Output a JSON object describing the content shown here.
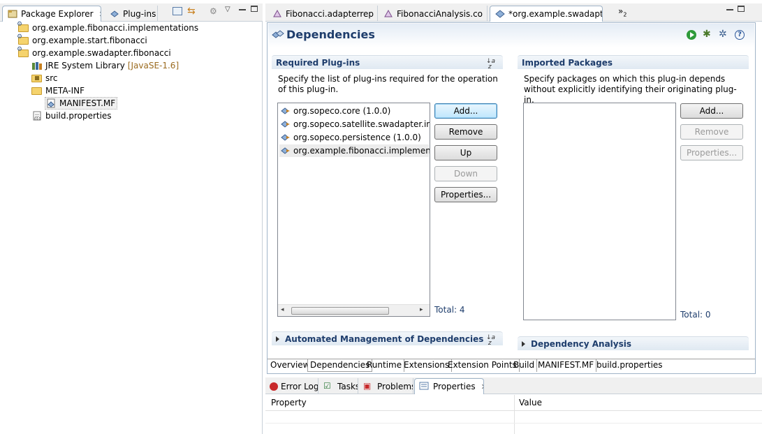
{
  "left_view": {
    "tabs": [
      {
        "label": "Package Explorer",
        "active": true
      },
      {
        "label": "Plug-ins",
        "active": false
      }
    ],
    "tree": [
      {
        "label": "org.example.fibonacci.implementations",
        "icon": "plugin-project-icon",
        "indent": 0
      },
      {
        "label": "org.example.start.fibonacci",
        "icon": "plugin-project-icon",
        "indent": 0
      },
      {
        "label": "org.example.swadapter.fibonacci",
        "icon": "plugin-project-icon",
        "indent": 0
      },
      {
        "label": "JRE System Library",
        "suffix": "[JavaSE-1.6]",
        "icon": "library-icon",
        "indent": 1
      },
      {
        "label": "src",
        "icon": "source-folder-icon",
        "indent": 1
      },
      {
        "label": "META-INF",
        "icon": "folder-icon",
        "indent": 1
      },
      {
        "label": "MANIFEST.MF",
        "icon": "manifest-file-icon",
        "indent": 2
      },
      {
        "label": "build.properties",
        "icon": "properties-file-icon",
        "indent": 1
      }
    ]
  },
  "editor": {
    "tabs": [
      {
        "label": "Fibonacci.adapterrep",
        "active": false
      },
      {
        "label": "FibonacciAnalysis.co",
        "active": false
      },
      {
        "label": "*org.example.swadapt",
        "active": true
      }
    ],
    "overflow_count": "2",
    "title": "Dependencies",
    "required": {
      "heading": "Required Plug-ins",
      "description": "Specify the list of plug-ins required for the operation of this plug-in.",
      "items": [
        "org.sopeco.core (1.0.0)",
        "org.sopeco.satellite.swadapter.interfaces",
        "org.sopeco.persistence (1.0.0)",
        "org.example.fibonacci.implementations"
      ],
      "buttons": {
        "add": "Add...",
        "remove": "Remove",
        "up": "Up",
        "down": "Down",
        "properties": "Properties..."
      },
      "total": "Total: 4"
    },
    "imported": {
      "heading": "Imported Packages",
      "description": "Specify packages on which this plug-in depends without explicitly identifying their originating plug-in.",
      "buttons": {
        "add": "Add...",
        "remove": "Remove",
        "properties": "Properties..."
      },
      "total": "Total: 0"
    },
    "automated": {
      "heading": "Automated Management of Dependencies"
    },
    "analysis": {
      "heading": "Dependency Analysis"
    },
    "page_tabs": [
      "Overview",
      "Dependencies",
      "Runtime",
      "Extensions",
      "Extension Points",
      "Build",
      "MANIFEST.MF",
      "build.properties"
    ]
  },
  "bottom_view": {
    "tabs": [
      {
        "label": "Error Log",
        "active": false
      },
      {
        "label": "Tasks",
        "active": false
      },
      {
        "label": "Problems",
        "active": false
      },
      {
        "label": "Properties",
        "active": true
      }
    ],
    "columns": [
      "Property",
      "Value"
    ]
  },
  "colors": {
    "heading": "#1e3d6c",
    "accent": "#2b579a",
    "suffix": "#9b6b1f"
  }
}
